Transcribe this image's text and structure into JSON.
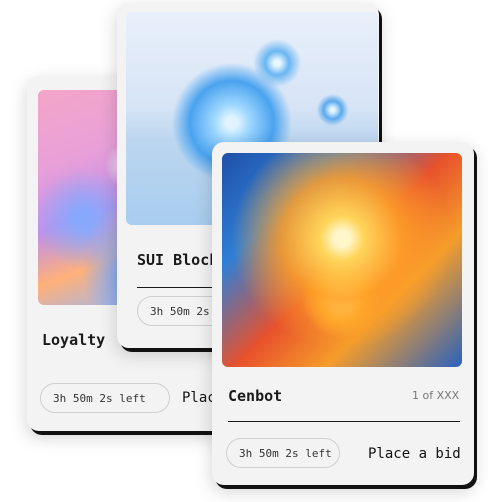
{
  "cards": [
    {
      "title": "Loyalty",
      "timer": "3h 50m 2s left",
      "bid_label": "Place a bid",
      "image": "abstract-pastel-liquid-art"
    },
    {
      "title": "SUI Block",
      "timer": "3h 50m 2s left",
      "image": "blue-spheres-on-water-art"
    },
    {
      "title": "Cenbot",
      "edition": "1 of XXX",
      "timer": "3h 50m 2s left",
      "bid_label": "Place a bid",
      "image": "golden-winged-deity-art"
    }
  ]
}
